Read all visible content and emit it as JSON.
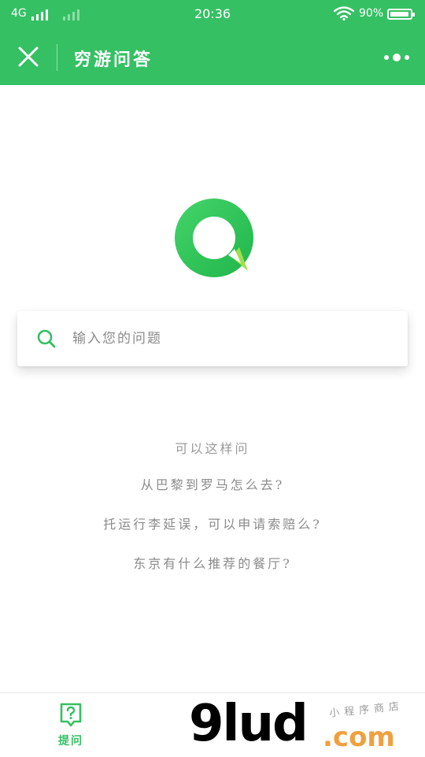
{
  "status_bar": {
    "network": "4G",
    "time": "20:36",
    "battery_percent": "90%",
    "battery_level": 0.9
  },
  "header": {
    "title": "穷游问答",
    "close_icon": "close-icon",
    "more_icon": "more-dots-icon"
  },
  "colors": {
    "brand_green": "#35c063",
    "text_gray": "#8a8a8a"
  },
  "search": {
    "placeholder": "输入您的问题",
    "icon": "search-icon"
  },
  "hints": {
    "title": "可以这样问",
    "items": [
      "从巴黎到罗马怎么去?",
      "托运行李延误，可以申请索赔么?",
      "东京有什么推荐的餐厅?"
    ]
  },
  "bottom_nav": {
    "tabs": [
      {
        "label": "提问",
        "icon": "question-icon",
        "active": true
      }
    ]
  },
  "watermark": {
    "brand": "9lud",
    "domain": ".com",
    "tagline": "小程序商店"
  }
}
